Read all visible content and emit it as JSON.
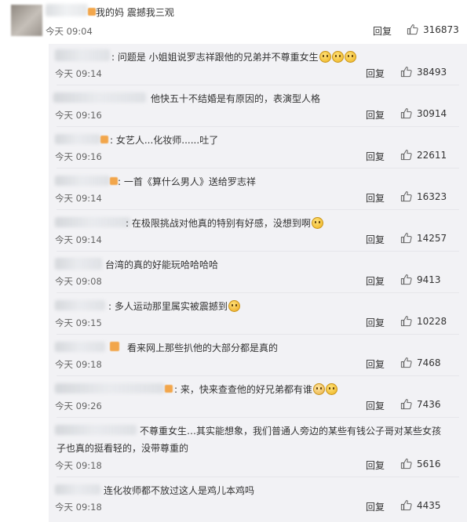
{
  "colors": {
    "panel_bg": "#f2f2f5",
    "text": "#333333",
    "time": "#666666",
    "accent_tag": "#f2a64b"
  },
  "main_comment": {
    "text": "我的妈 震撼我三观",
    "time": "今天 09:04",
    "reply_label": "回复",
    "likes": "316873"
  },
  "comments": [
    {
      "text": "问题是 小姐姐说罗志祥跟他的兄弟并不尊重女生",
      "emojis": [
        "smile",
        "smile",
        "smile"
      ],
      "time": "今天 09:14",
      "reply_label": "回复",
      "likes": "38493"
    },
    {
      "text": "他快五十不结婚是有原因的，表演型人格",
      "emojis": [],
      "time": "今天 09:16",
      "reply_label": "回复",
      "likes": "30914"
    },
    {
      "text": "女艺人...化妆师......吐了",
      "emojis": [],
      "time": "今天 09:16",
      "reply_label": "回复",
      "likes": "22611"
    },
    {
      "text": "一首《算什么男人》送给罗志祥",
      "emojis": [],
      "time": "今天 09:14",
      "reply_label": "回复",
      "likes": "16323"
    },
    {
      "text": "在极限挑战对他真的特别有好感，没想到啊",
      "emojis": [
        "sweat"
      ],
      "time": "今天 09:14",
      "reply_label": "回复",
      "likes": "14257"
    },
    {
      "text": "台湾的真的好能玩哈哈哈哈",
      "emojis": [],
      "time": "今天 09:08",
      "reply_label": "回复",
      "likes": "9413"
    },
    {
      "text": "多人运动那里属实被震撼到",
      "emojis": [
        "wow"
      ],
      "time": "今天 09:15",
      "reply_label": "回复",
      "likes": "10228"
    },
    {
      "text": "看来网上那些扒他的大部分都是真的",
      "emojis": [],
      "time": "今天 09:18",
      "reply_label": "回复",
      "likes": "7468"
    },
    {
      "text": "来，快来查查他的好兄弟都有谁",
      "emojis": [
        "dog",
        "smile"
      ],
      "time": "今天 09:26",
      "reply_label": "回复",
      "likes": "7436"
    },
    {
      "text": "不尊重女生…其实能想象，我们普通人旁边的某些有钱公子哥对某些女孩",
      "text2": "子也真的挺看轻的，没带尊重的",
      "emojis": [],
      "time": "今天 09:18",
      "reply_label": "回复",
      "likes": "5616"
    },
    {
      "text": "连化妆师都不放过这人是鸡儿本鸡吗",
      "emojis": [],
      "time": "今天 09:18",
      "reply_label": "回复",
      "likes": "4435"
    }
  ]
}
